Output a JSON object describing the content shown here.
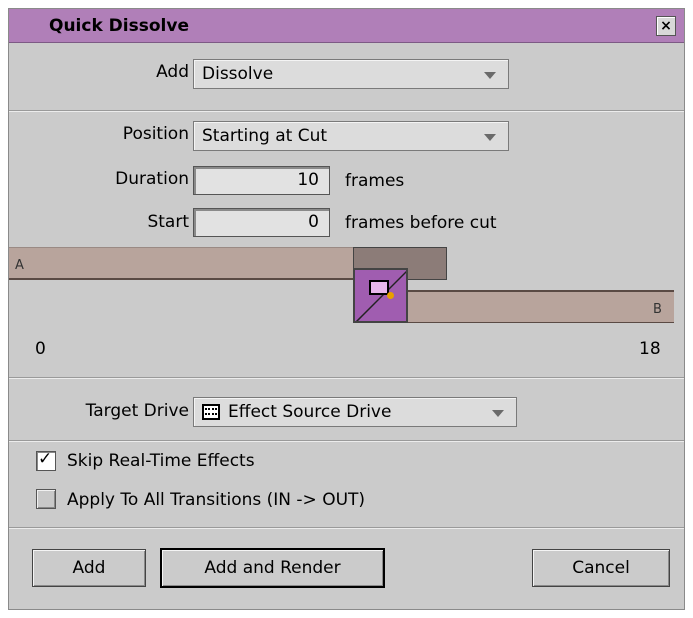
{
  "window": {
    "title": "Quick Dissolve",
    "close_glyph": "×"
  },
  "add": {
    "label": "Add",
    "selected": "Dissolve"
  },
  "position": {
    "label": "Position",
    "selected": "Starting at Cut"
  },
  "duration": {
    "label": "Duration",
    "value": "10",
    "unit": "frames"
  },
  "start": {
    "label": "Start",
    "value": "0",
    "unit": "frames before cut"
  },
  "timeline": {
    "clip_a_label": "A",
    "clip_b_label": "B",
    "min_tick": "0",
    "max_tick": "18",
    "effect_icon": "dissolve-effect-icon"
  },
  "target_drive": {
    "label": "Target Drive",
    "selected": "Effect Source Drive",
    "icon": "drive-icon"
  },
  "options": {
    "skip_realtime": {
      "label": "Skip Real-Time Effects",
      "checked": true
    },
    "apply_all": {
      "label": "Apply To All Transitions (IN -> OUT)",
      "checked": false
    }
  },
  "buttons": {
    "add": "Add",
    "add_render": "Add and Render",
    "cancel": "Cancel"
  },
  "colors": {
    "title_bar": "#b07fb8",
    "effect": "#a05db0",
    "clip": "#b8a49c"
  }
}
